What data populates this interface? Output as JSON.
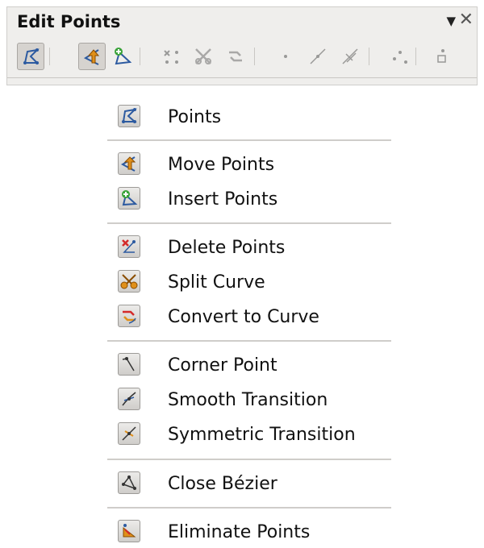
{
  "toolbar": {
    "title": "Edit Points",
    "dropdown_glyph": "▼",
    "close_glyph": "✕",
    "icons": [
      "points-icon",
      "move-points-icon",
      "insert-points-icon",
      "delete-points-icon",
      "split-curve-icon",
      "convert-to-curve-icon",
      "corner-point-icon",
      "smooth-transition-icon",
      "symmetric-transition-icon",
      "close-bezier-icon",
      "eliminate-points-icon"
    ]
  },
  "menu": {
    "items": [
      {
        "label": "Points",
        "icon": "points-icon"
      },
      {
        "label": "Move Points",
        "icon": "move-points-icon"
      },
      {
        "label": "Insert Points",
        "icon": "insert-points-icon"
      },
      {
        "label": "Delete Points",
        "icon": "delete-points-icon"
      },
      {
        "label": "Split Curve",
        "icon": "split-curve-icon"
      },
      {
        "label": "Convert to Curve",
        "icon": "convert-to-curve-icon"
      },
      {
        "label": "Corner Point",
        "icon": "corner-point-icon"
      },
      {
        "label": "Smooth Transition",
        "icon": "smooth-transition-icon"
      },
      {
        "label": "Symmetric Transition",
        "icon": "symmetric-transition-icon"
      },
      {
        "label": "Close Bézier",
        "icon": "close-bezier-icon"
      },
      {
        "label": "Eliminate Points",
        "icon": "eliminate-points-icon"
      }
    ]
  },
  "colors": {
    "accent": "#3a6fb5",
    "orange": "#e0901a",
    "red": "#d42a2a",
    "green": "#3aa33a"
  }
}
